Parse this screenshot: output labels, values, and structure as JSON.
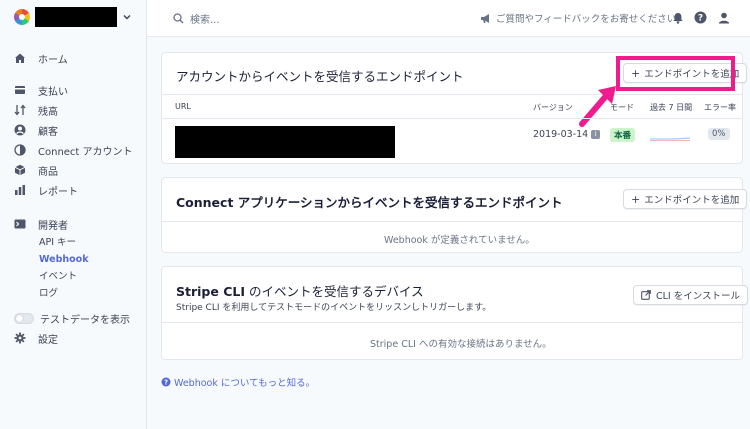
{
  "sidebar": {
    "items": [
      {
        "label": "ホーム"
      },
      {
        "label": "支払い"
      },
      {
        "label": "残高"
      },
      {
        "label": "顧客"
      },
      {
        "label": "Connect アカウント"
      },
      {
        "label": "商品"
      },
      {
        "label": "レポート"
      },
      {
        "label": "開発者"
      }
    ],
    "developer_sub": [
      {
        "label": "API キー"
      },
      {
        "label": "Webhook"
      },
      {
        "label": "イベント"
      },
      {
        "label": "ログ"
      }
    ],
    "test_toggle_label": "テストデータを表示",
    "settings_label": "設定"
  },
  "topbar": {
    "search_placeholder": "検索...",
    "feedback_label": "ご質問やフィードバックをお寄せください。"
  },
  "endpoints_card": {
    "title": "アカウントからイベントを受信するエンドポイント",
    "add_button": "エンドポイントを追加",
    "columns": {
      "url": "URL",
      "version": "バージョン",
      "mode": "モード",
      "last7": "過去 7 日間",
      "error_rate": "エラー率"
    },
    "row": {
      "version": "2019-03-14",
      "mode": "本番",
      "error_rate": "0%"
    }
  },
  "connect_card": {
    "title": "Connect アプリケーションからイベントを受信するエンドポイント",
    "add_button": "エンドポイントを追加",
    "empty": "Webhook が定義されていません。"
  },
  "cli_card": {
    "title_bold": "Stripe CLI",
    "title_rest": " のイベントを受信するデバイス",
    "subtitle": "Stripe CLI を利用してテストモードのイベントをリッスンしトリガーします。",
    "install_button": "CLI をインストール",
    "empty": "Stripe CLI への有効な接続はありません。"
  },
  "learn_more": "Webhook についてもっと知る。",
  "colors": {
    "accent": "#5469d4",
    "highlight": "#ee1c8d",
    "mode_badge_bg": "#cbf4c9"
  }
}
